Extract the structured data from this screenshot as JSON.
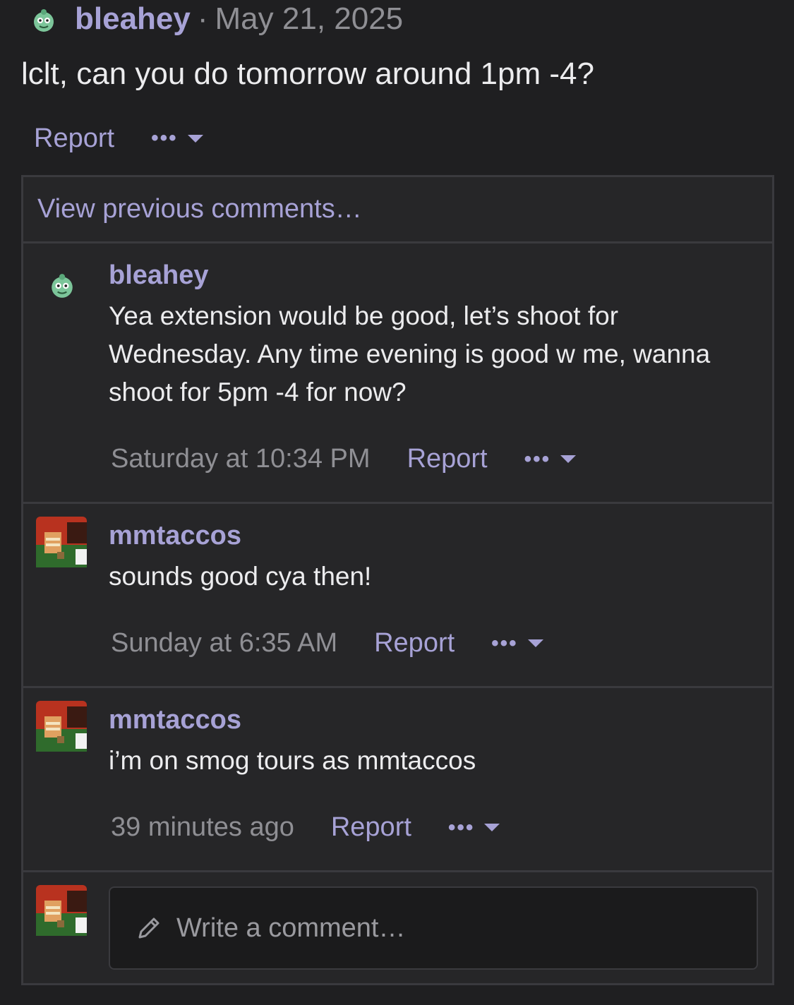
{
  "post": {
    "author": "bleahey",
    "separator": "·",
    "date": "May 21, 2025",
    "body": "lclt, can you do tomorrow around 1pm -4?",
    "report_label": "Report",
    "more_dots": "•••"
  },
  "comments": {
    "view_previous": "View previous comments…",
    "items": [
      {
        "author": "bleahey",
        "avatar": "green-character-icon",
        "text": "Yea extension would be good, let’s shoot for Wednesday. Any time evening is good w me, wanna shoot for 5pm -4 for now?",
        "time": "Saturday at 10:34 PM",
        "report_label": "Report",
        "more_dots": "•••"
      },
      {
        "author": "mmtaccos",
        "avatar": "pixel-art-avatar",
        "text": "sounds good cya then!",
        "time": "Sunday at 6:35 AM",
        "report_label": "Report",
        "more_dots": "•••"
      },
      {
        "author": "mmtaccos",
        "avatar": "pixel-art-avatar",
        "text": "i’m on smog tours as mmtaccos",
        "time": "39 minutes ago",
        "report_label": "Report",
        "more_dots": "•••"
      }
    ],
    "composer_placeholder": "Write a comment…"
  },
  "colors": {
    "background": "#1f1f21",
    "panel": "#262628",
    "accent": "#a7a2d6",
    "muted": "#8f8f94",
    "border": "#3a3a3e"
  }
}
